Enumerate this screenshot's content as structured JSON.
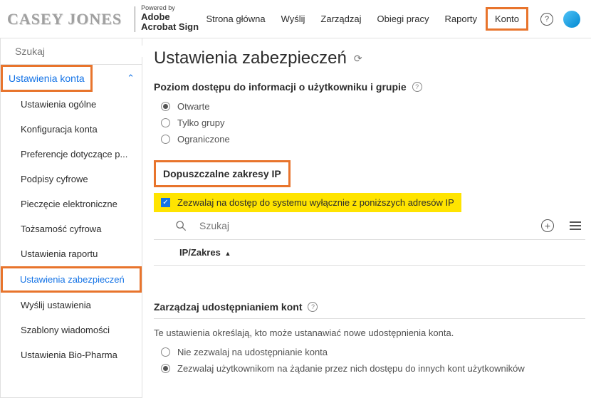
{
  "header": {
    "logo_text": "CASEY JONES",
    "powered_label": "Powered by",
    "brand_line1": "Adobe",
    "brand_line2": "Acrobat Sign",
    "nav": [
      "Strona główna",
      "Wyślij",
      "Zarządzaj",
      "Obiegi pracy",
      "Raporty",
      "Konto"
    ],
    "nav_highlighted_index": 5,
    "help_glyph": "?"
  },
  "sidebar": {
    "search_placeholder": "Szukaj",
    "section_label": "Ustawienia konta",
    "items": [
      "Ustawienia ogólne",
      "Konfiguracja konta",
      "Preferencje dotyczące p...",
      "Podpisy cyfrowe",
      "Pieczęcie elektroniczne",
      "Tożsamość cyfrowa",
      "Ustawienia raportu",
      "Ustawienia zabezpieczeń",
      "Wyślij ustawienia",
      "Szablony wiadomości",
      "Ustawienia Bio-Pharma"
    ],
    "highlighted_index": 7
  },
  "main": {
    "title": "Ustawienia zabezpieczeń",
    "access_level": {
      "heading": "Poziom dostępu do informacji o użytkowniku i grupie",
      "options": [
        "Otwarte",
        "Tylko grupy",
        "Ograniczone"
      ],
      "selected_index": 0
    },
    "ip_section": {
      "heading": "Dopuszczalne zakresy IP",
      "checkbox_label": "Zezwalaj na dostęp do systemu wyłącznie z poniższych adresów IP",
      "checkbox_checked": true,
      "search_placeholder": "Szukaj",
      "column_header": "IP/Zakres",
      "sort_glyph": "▲"
    },
    "sharing_section": {
      "heading": "Zarządzaj udostępnianiem kont",
      "desc": "Te ustawienia określają, kto może ustanawiać nowe udostępnienia konta.",
      "options": [
        "Nie zezwalaj na udostępnianie konta",
        "Zezwalaj użytkownikom na żądanie przez nich dostępu do innych kont użytkowników"
      ],
      "selected_index": 1
    }
  }
}
